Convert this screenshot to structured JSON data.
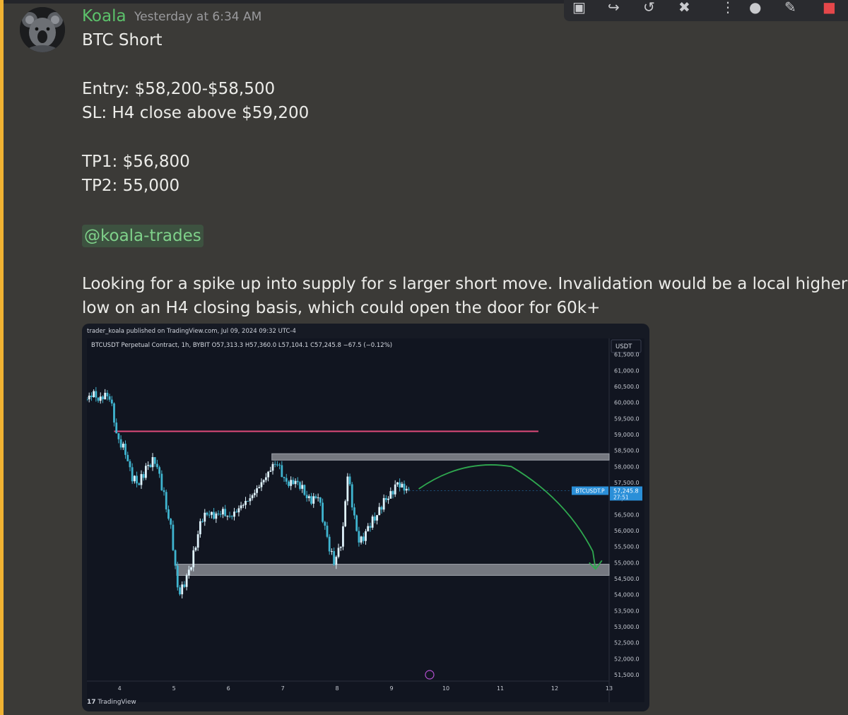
{
  "message": {
    "author": "Koala",
    "timestamp": "Yesterday at 6:34 AM",
    "lines": [
      "BTC Short",
      "Entry: $58,200-$58,500",
      "SL: H4 close above $59,200",
      "TP1: $56,800",
      "TP2: 55,000",
      "Looking for a spike up into supply for s larger short move. Invalidation would be a local higher",
      "low on an H4 closing basis, which could open the door for 60k+"
    ],
    "mention": "@koala-trades"
  },
  "toolbar": {
    "icons": [
      "app-icon",
      "reply-icon",
      "forward-icon",
      "pin-icon",
      "more-icon",
      "reaction-icon",
      "edit-icon",
      "delete-icon"
    ]
  },
  "colors": {
    "author": "#5cc26b",
    "mention_bar": "#f0b232",
    "resistance_line": "#e04a7a",
    "projection_arrow": "#2fa84f",
    "candle_up": "#dff2fb",
    "candle_down": "#3fb4cf",
    "price_tag": "#2a8fd8"
  },
  "chart": {
    "published": "trader_koala published on TradingView.com, Jul 09, 2024 09:32 UTC-4",
    "legend": "BTCUSDT Perpetual Contract, 1h, BYBIT  O57,313.3  H57,360.0  L57,104.1  C57,245.8  −67.5 (−0.12%)",
    "currency": "USDT",
    "price_tag_symbol": "BTCUSDT.P",
    "price_tag_value": "57,245.8",
    "price_tag_timer": "27:51",
    "logo": "TradingView",
    "y_ticks": [
      "61,500.0",
      "61,000.0",
      "60,500.0",
      "60,000.0",
      "59,500.0",
      "59,000.0",
      "58,500.0",
      "58,000.0",
      "57,500.0",
      "57,000.0",
      "56,500.0",
      "56,000.0",
      "55,500.0",
      "55,000.0",
      "54,500.0",
      "54,000.0",
      "53,500.0",
      "53,000.0",
      "52,500.0",
      "52,000.0",
      "51,500.0"
    ],
    "x_ticks": [
      "4",
      "5",
      "6",
      "7",
      "8",
      "9",
      "10",
      "11",
      "12",
      "13"
    ]
  },
  "chart_data": {
    "type": "candlestick",
    "title": "BTCUSDT Perpetual Contract, 1h, BYBIT",
    "y_axis_label": "USDT",
    "ylim": [
      51300,
      62000
    ],
    "x_range_days": [
      3.4,
      13.0
    ],
    "current_price": 57245.8,
    "levels": [
      {
        "name": "stop-loss-line",
        "price": 59100,
        "day_from": 3.9,
        "day_to": 11.7
      },
      {
        "name": "supply-zone",
        "price_high": 58400,
        "price_low": 58200,
        "day_from": 6.8,
        "day_to": 13.0
      },
      {
        "name": "demand-zone",
        "price_high": 54950,
        "price_low": 54600,
        "day_from": 5.05,
        "day_to": 13.35
      }
    ],
    "projection_points": [
      [
        9.5,
        57300
      ],
      [
        10.3,
        58250
      ],
      [
        11.2,
        58000
      ],
      [
        12.2,
        57000
      ],
      [
        12.7,
        55350
      ],
      [
        12.75,
        54800
      ]
    ],
    "price_path": [
      [
        3.4,
        60100
      ],
      [
        3.52,
        60300
      ],
      [
        3.62,
        60050
      ],
      [
        3.72,
        60250
      ],
      [
        3.82,
        60150
      ],
      [
        3.88,
        59700
      ],
      [
        3.95,
        58900
      ],
      [
        4.1,
        58500
      ],
      [
        4.22,
        57700
      ],
      [
        4.35,
        57450
      ],
      [
        4.5,
        58000
      ],
      [
        4.65,
        58200
      ],
      [
        4.75,
        57600
      ],
      [
        4.85,
        56800
      ],
      [
        4.95,
        56000
      ],
      [
        5.0,
        55300
      ],
      [
        5.05,
        54300
      ],
      [
        5.12,
        54050
      ],
      [
        5.2,
        54400
      ],
      [
        5.3,
        54850
      ],
      [
        5.4,
        55550
      ],
      [
        5.5,
        56350
      ],
      [
        5.62,
        56550
      ],
      [
        5.75,
        56450
      ],
      [
        5.9,
        56600
      ],
      [
        6.0,
        56400
      ],
      [
        6.12,
        56550
      ],
      [
        6.25,
        56800
      ],
      [
        6.4,
        57000
      ],
      [
        6.55,
        57350
      ],
      [
        6.7,
        57700
      ],
      [
        6.82,
        58050
      ],
      [
        6.92,
        58100
      ],
      [
        7.0,
        57650
      ],
      [
        7.1,
        57450
      ],
      [
        7.22,
        57550
      ],
      [
        7.35,
        57350
      ],
      [
        7.45,
        57000
      ],
      [
        7.55,
        56950
      ],
      [
        7.65,
        57100
      ],
      [
        7.72,
        56500
      ],
      [
        7.8,
        55900
      ],
      [
        7.88,
        55300
      ],
      [
        7.95,
        55000
      ],
      [
        8.05,
        55500
      ],
      [
        8.12,
        56100
      ],
      [
        8.18,
        57850
      ],
      [
        8.26,
        57050
      ],
      [
        8.34,
        56100
      ],
      [
        8.42,
        55600
      ],
      [
        8.5,
        55850
      ],
      [
        8.6,
        56200
      ],
      [
        8.72,
        56450
      ],
      [
        8.85,
        56900
      ],
      [
        9.0,
        57150
      ],
      [
        9.1,
        57500
      ],
      [
        9.2,
        57350
      ],
      [
        9.32,
        57250
      ]
    ]
  }
}
